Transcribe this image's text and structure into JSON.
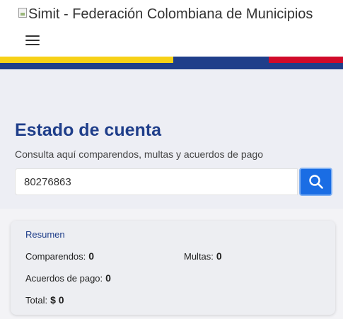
{
  "header": {
    "logo_alt": "Simit - Federación Colombiana de Municipios",
    "menu_icon": "hamburger-menu-icon"
  },
  "colors": {
    "flag_yellow": "#f7d117",
    "flag_blue": "#1f3e8a",
    "flag_red": "#d10b2a",
    "search_button": "#1a6de4",
    "title_color": "#1f3e8a"
  },
  "hero": {
    "title": "Estado de cuenta",
    "subtitle": "Consulta aquí comparendos, multas y acuerdos de pago",
    "search_value": "80276863",
    "search_icon": "search-icon"
  },
  "summary": {
    "title": "Resumen",
    "comparendos_label": "Comparendos:",
    "comparendos_value": "0",
    "multas_label": "Multas:",
    "multas_value": "0",
    "acuerdos_label": "Acuerdos de pago:",
    "acuerdos_value": "0",
    "total_label": "Total:",
    "total_value": "$ 0"
  }
}
